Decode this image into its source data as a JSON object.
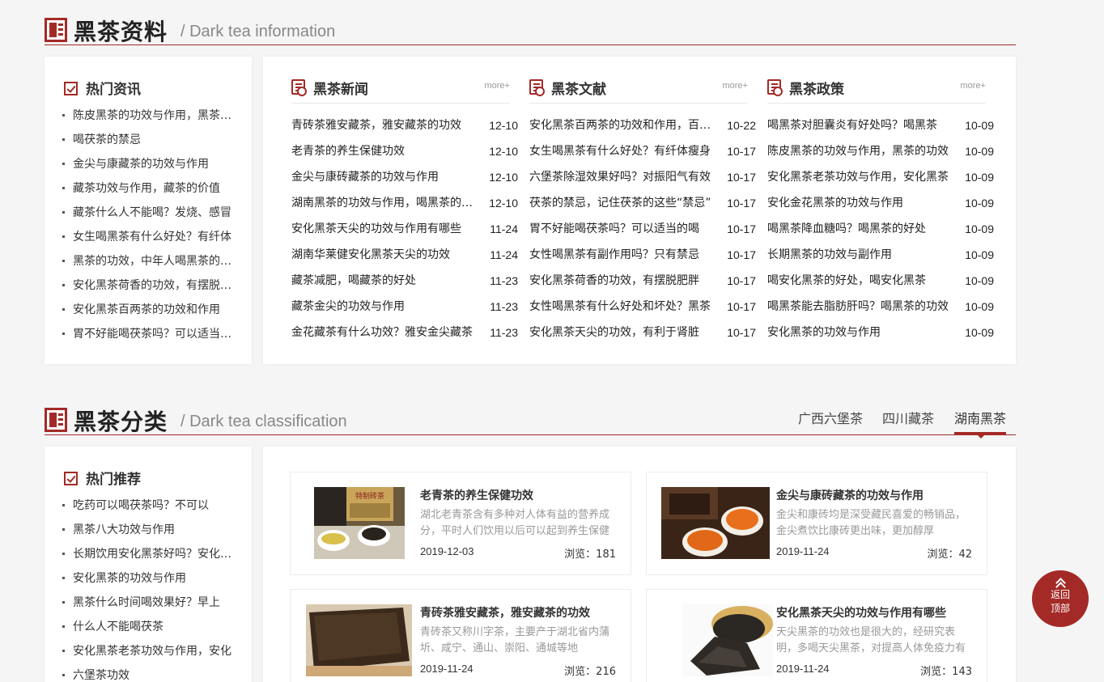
{
  "section1": {
    "title": "黑茶资料",
    "subtitle": "/ Dark tea information",
    "hot": {
      "title": "热门资讯",
      "items": [
        "陈皮黑茶的功效与作用，黑茶的功效",
        "喝茯茶的禁忌",
        "金尖与康藏茶的功效与作用",
        "藏茶功效与作用，藏茶的价值",
        "藏茶什么人不能喝？发烧、感冒",
        "女生喝黑茶有什么好处？有纤体",
        "黑茶的功效，中年人喝黑茶的好处",
        "安化黑茶荷香的功效，有摆脱肥胖",
        "安化黑茶百两茶的功效和作用",
        "胃不好能喝茯茶吗？可以适当的喝"
      ]
    },
    "columns": [
      {
        "title": "黑茶新闻",
        "more": "more+",
        "items": [
          {
            "t": "青砖茶雅安藏茶，雅安藏茶的功效",
            "d": "12-10"
          },
          {
            "t": "老青茶的养生保健功效",
            "d": "12-10"
          },
          {
            "t": "金尖与康砖藏茶的功效与作用",
            "d": "12-10"
          },
          {
            "t": "湖南黑茶的功效与作用，喝黑茶的好处",
            "d": "12-10"
          },
          {
            "t": "安化黑茶天尖的功效与作用有哪些",
            "d": "11-24"
          },
          {
            "t": "湖南华莱健安化黑茶天尖的功效",
            "d": "11-24"
          },
          {
            "t": "藏茶减肥，喝藏茶的好处",
            "d": "11-23"
          },
          {
            "t": "藏茶金尖的功效与作用",
            "d": "11-23"
          },
          {
            "t": "金花藏茶有什么功效？雅安金尖藏茶",
            "d": "11-23"
          }
        ]
      },
      {
        "title": "黑茶文献",
        "more": "more+",
        "items": [
          {
            "t": "安化黑茶百两茶的功效和作用，百两茶",
            "d": "10-22"
          },
          {
            "t": "女生喝黑茶有什么好处？有纤体瘦身",
            "d": "10-17"
          },
          {
            "t": "六堡茶除湿效果好吗？对振阳气有效",
            "d": "10-17"
          },
          {
            "t": "茯茶的禁忌，记住茯茶的这些“禁忌”",
            "d": "10-17"
          },
          {
            "t": "胃不好能喝茯茶吗？可以适当的喝",
            "d": "10-17"
          },
          {
            "t": "女性喝黑茶有副作用吗？只有禁忌",
            "d": "10-17"
          },
          {
            "t": "安化黑茶荷香的功效，有摆脱肥胖",
            "d": "10-17"
          },
          {
            "t": "女性喝黑茶有什么好处和坏处？黑茶",
            "d": "10-17"
          },
          {
            "t": "安化黑茶天尖的功效，有利于肾脏",
            "d": "10-17"
          }
        ]
      },
      {
        "title": "黑茶政策",
        "more": "more+",
        "items": [
          {
            "t": "喝黑茶对胆囊炎有好处吗？喝黑茶",
            "d": "10-09"
          },
          {
            "t": "陈皮黑茶的功效与作用，黑茶的功效",
            "d": "10-09"
          },
          {
            "t": "安化黑茶老茶功效与作用，安化黑茶",
            "d": "10-09"
          },
          {
            "t": "安化金花黑茶的功效与作用",
            "d": "10-09"
          },
          {
            "t": "喝黑茶降血糖吗？喝黑茶的好处",
            "d": "10-09"
          },
          {
            "t": "长期黑茶的功效与副作用",
            "d": "10-09"
          },
          {
            "t": "喝安化黑茶的好处，喝安化黑茶",
            "d": "10-09"
          },
          {
            "t": "喝黑茶能去脂肪肝吗？喝黑茶的功效",
            "d": "10-09"
          },
          {
            "t": "安化黑茶的功效与作用",
            "d": "10-09"
          }
        ]
      }
    ]
  },
  "section2": {
    "title": "黑茶分类",
    "subtitle": "/ Dark tea classification",
    "tabs": [
      "广西六堡茶",
      "四川藏茶",
      "湖南黑茶"
    ],
    "hot": {
      "title": "热门推荐",
      "items": [
        "吃药可以喝茯茶吗？不可以",
        "黑茶八大功效与作用",
        "长期饮用安化黑茶好吗？安化黑茶",
        "安化黑茶的功效与作用",
        "黑茶什么时间喝效果好？早上",
        "什么人不能喝茯茶",
        "安化黑茶老茶功效与作用，安化",
        "六堡茶功效"
      ]
    },
    "articles": [
      {
        "title": "老青茶的养生保健功效",
        "desc": "湖北老青茶含有多种对人体有益的营养成分，平时人们饮用以后可以起到养生保健作用",
        "date": "2019-12-03",
        "views": "浏览：181"
      },
      {
        "title": "金尖与康砖藏茶的功效与作用",
        "desc": "金尖和康砖均是深受藏民喜爱的畅销品，金尖煮饮比康砖更出味，更加醇厚",
        "date": "2019-11-24",
        "views": "浏览：42"
      },
      {
        "title": "青砖茶雅安藏茶，雅安藏茶的功效",
        "desc": "青砖茶又称川字茶，主要产于湖北省内蒲圻、咸宁、通山、崇阳、通城等地",
        "date": "2019-11-24",
        "views": "浏览：216"
      },
      {
        "title": "安化黑茶天尖的功效与作用有哪些",
        "desc": "天尖黑茶的功效也是很大的，经研究表明，多喝天尖黑茶，对提高人体免疫力有益",
        "date": "2019-11-24",
        "views": "浏览：143"
      }
    ]
  },
  "thumb_label": "特制砖茶",
  "back_top": {
    "line1": "返回",
    "line2": "顶部"
  }
}
